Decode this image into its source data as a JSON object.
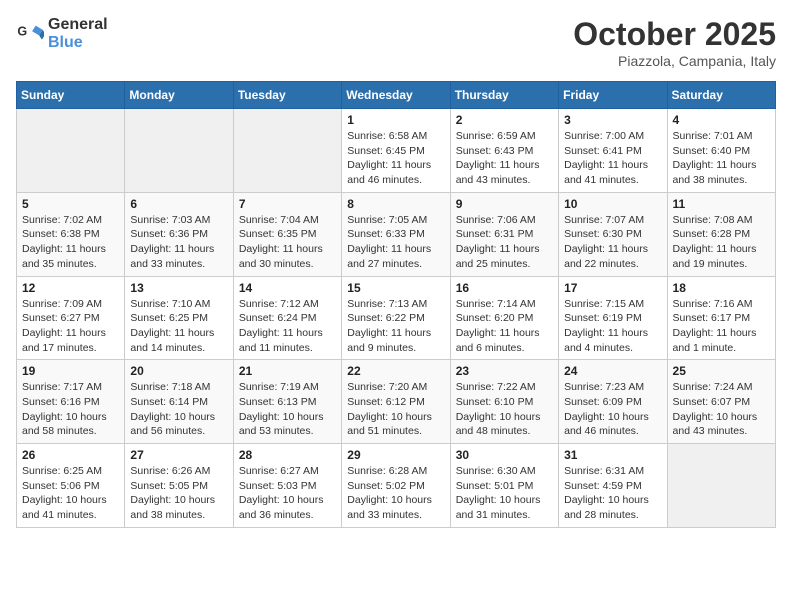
{
  "header": {
    "logo_line1": "General",
    "logo_line2": "Blue",
    "month": "October 2025",
    "location": "Piazzola, Campania, Italy"
  },
  "weekdays": [
    "Sunday",
    "Monday",
    "Tuesday",
    "Wednesday",
    "Thursday",
    "Friday",
    "Saturday"
  ],
  "weeks": [
    [
      {
        "day": "",
        "info": ""
      },
      {
        "day": "",
        "info": ""
      },
      {
        "day": "",
        "info": ""
      },
      {
        "day": "1",
        "info": "Sunrise: 6:58 AM\nSunset: 6:45 PM\nDaylight: 11 hours\nand 46 minutes."
      },
      {
        "day": "2",
        "info": "Sunrise: 6:59 AM\nSunset: 6:43 PM\nDaylight: 11 hours\nand 43 minutes."
      },
      {
        "day": "3",
        "info": "Sunrise: 7:00 AM\nSunset: 6:41 PM\nDaylight: 11 hours\nand 41 minutes."
      },
      {
        "day": "4",
        "info": "Sunrise: 7:01 AM\nSunset: 6:40 PM\nDaylight: 11 hours\nand 38 minutes."
      }
    ],
    [
      {
        "day": "5",
        "info": "Sunrise: 7:02 AM\nSunset: 6:38 PM\nDaylight: 11 hours\nand 35 minutes."
      },
      {
        "day": "6",
        "info": "Sunrise: 7:03 AM\nSunset: 6:36 PM\nDaylight: 11 hours\nand 33 minutes."
      },
      {
        "day": "7",
        "info": "Sunrise: 7:04 AM\nSunset: 6:35 PM\nDaylight: 11 hours\nand 30 minutes."
      },
      {
        "day": "8",
        "info": "Sunrise: 7:05 AM\nSunset: 6:33 PM\nDaylight: 11 hours\nand 27 minutes."
      },
      {
        "day": "9",
        "info": "Sunrise: 7:06 AM\nSunset: 6:31 PM\nDaylight: 11 hours\nand 25 minutes."
      },
      {
        "day": "10",
        "info": "Sunrise: 7:07 AM\nSunset: 6:30 PM\nDaylight: 11 hours\nand 22 minutes."
      },
      {
        "day": "11",
        "info": "Sunrise: 7:08 AM\nSunset: 6:28 PM\nDaylight: 11 hours\nand 19 minutes."
      }
    ],
    [
      {
        "day": "12",
        "info": "Sunrise: 7:09 AM\nSunset: 6:27 PM\nDaylight: 11 hours\nand 17 minutes."
      },
      {
        "day": "13",
        "info": "Sunrise: 7:10 AM\nSunset: 6:25 PM\nDaylight: 11 hours\nand 14 minutes."
      },
      {
        "day": "14",
        "info": "Sunrise: 7:12 AM\nSunset: 6:24 PM\nDaylight: 11 hours\nand 11 minutes."
      },
      {
        "day": "15",
        "info": "Sunrise: 7:13 AM\nSunset: 6:22 PM\nDaylight: 11 hours\nand 9 minutes."
      },
      {
        "day": "16",
        "info": "Sunrise: 7:14 AM\nSunset: 6:20 PM\nDaylight: 11 hours\nand 6 minutes."
      },
      {
        "day": "17",
        "info": "Sunrise: 7:15 AM\nSunset: 6:19 PM\nDaylight: 11 hours\nand 4 minutes."
      },
      {
        "day": "18",
        "info": "Sunrise: 7:16 AM\nSunset: 6:17 PM\nDaylight: 11 hours\nand 1 minute."
      }
    ],
    [
      {
        "day": "19",
        "info": "Sunrise: 7:17 AM\nSunset: 6:16 PM\nDaylight: 10 hours\nand 58 minutes."
      },
      {
        "day": "20",
        "info": "Sunrise: 7:18 AM\nSunset: 6:14 PM\nDaylight: 10 hours\nand 56 minutes."
      },
      {
        "day": "21",
        "info": "Sunrise: 7:19 AM\nSunset: 6:13 PM\nDaylight: 10 hours\nand 53 minutes."
      },
      {
        "day": "22",
        "info": "Sunrise: 7:20 AM\nSunset: 6:12 PM\nDaylight: 10 hours\nand 51 minutes."
      },
      {
        "day": "23",
        "info": "Sunrise: 7:22 AM\nSunset: 6:10 PM\nDaylight: 10 hours\nand 48 minutes."
      },
      {
        "day": "24",
        "info": "Sunrise: 7:23 AM\nSunset: 6:09 PM\nDaylight: 10 hours\nand 46 minutes."
      },
      {
        "day": "25",
        "info": "Sunrise: 7:24 AM\nSunset: 6:07 PM\nDaylight: 10 hours\nand 43 minutes."
      }
    ],
    [
      {
        "day": "26",
        "info": "Sunrise: 6:25 AM\nSunset: 5:06 PM\nDaylight: 10 hours\nand 41 minutes."
      },
      {
        "day": "27",
        "info": "Sunrise: 6:26 AM\nSunset: 5:05 PM\nDaylight: 10 hours\nand 38 minutes."
      },
      {
        "day": "28",
        "info": "Sunrise: 6:27 AM\nSunset: 5:03 PM\nDaylight: 10 hours\nand 36 minutes."
      },
      {
        "day": "29",
        "info": "Sunrise: 6:28 AM\nSunset: 5:02 PM\nDaylight: 10 hours\nand 33 minutes."
      },
      {
        "day": "30",
        "info": "Sunrise: 6:30 AM\nSunset: 5:01 PM\nDaylight: 10 hours\nand 31 minutes."
      },
      {
        "day": "31",
        "info": "Sunrise: 6:31 AM\nSunset: 4:59 PM\nDaylight: 10 hours\nand 28 minutes."
      },
      {
        "day": "",
        "info": ""
      }
    ]
  ]
}
